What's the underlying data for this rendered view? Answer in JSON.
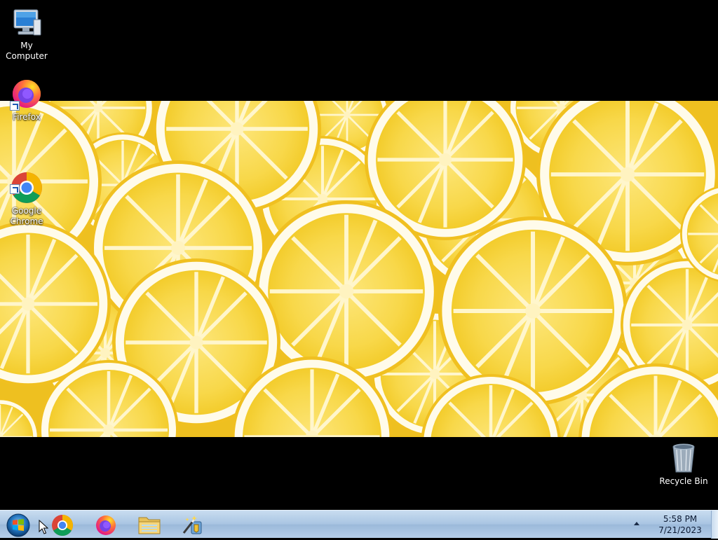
{
  "desktop": {
    "icons": [
      {
        "label": "My Computer",
        "icon": "computer-icon"
      },
      {
        "label": "Firefox",
        "icon": "firefox-icon"
      },
      {
        "label": "Google\nChrome",
        "icon": "chrome-icon"
      },
      {
        "label": "Recycle Bin",
        "icon": "recycle-bin-icon"
      }
    ],
    "wallpaper": "lemon-slices"
  },
  "taskbar": {
    "start": {
      "icon": "windows-start-icon"
    },
    "pinned": [
      {
        "name": "Google Chrome",
        "icon": "chrome-icon"
      },
      {
        "name": "Firefox",
        "icon": "firefox-icon"
      },
      {
        "name": "File Explorer",
        "icon": "folder-icon"
      },
      {
        "name": "Setup Wizard",
        "icon": "wizard-icon"
      }
    ],
    "clock": {
      "time": "5:58 PM",
      "date": "7/21/2023"
    }
  },
  "colors": {
    "lemon": "#f5c927",
    "pith": "#fffbe8",
    "taskbar": "#b4cde8"
  }
}
